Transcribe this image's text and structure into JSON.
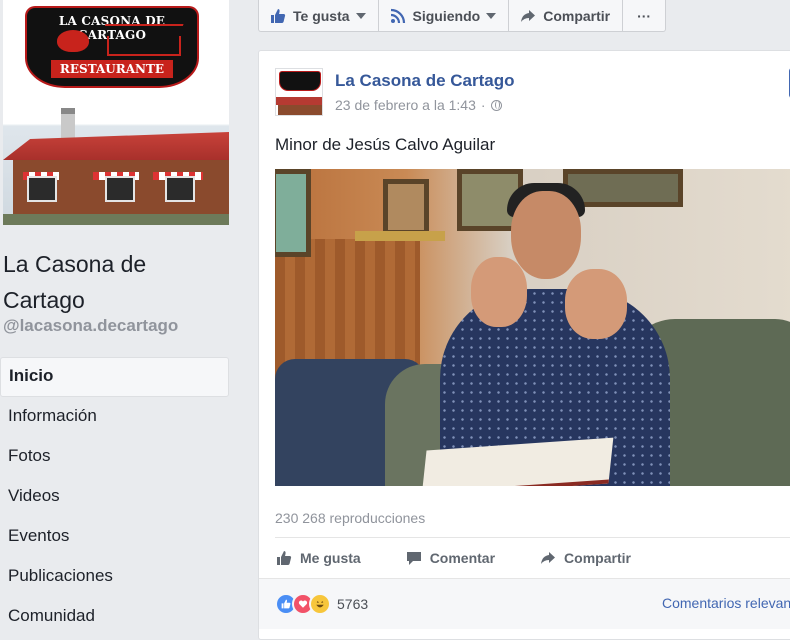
{
  "page": {
    "cover_sign_top": "LA CASONA DE CARTAGO",
    "cover_sign_bottom": "RESTAURANTE",
    "name": "La Casona de Cartago",
    "handle": "@lacasona.decartago"
  },
  "nav": {
    "items": [
      {
        "label": "Inicio",
        "active": true
      },
      {
        "label": "Información"
      },
      {
        "label": "Fotos"
      },
      {
        "label": "Videos"
      },
      {
        "label": "Eventos"
      },
      {
        "label": "Publicaciones"
      },
      {
        "label": "Comunidad"
      }
    ]
  },
  "actionbar": {
    "like_label": "Te gusta",
    "follow_label": "Siguiendo",
    "share_label": "Compartir",
    "more_label": "···"
  },
  "post": {
    "author": "La Casona de Cartago",
    "date": "23 de febrero a la 1:43",
    "separator": "·",
    "text": "Minor de Jesús Calvo Aguilar",
    "views": "230 268 reproducciones",
    "actions": {
      "like": "Me gusta",
      "comment": "Comentar",
      "share": "Compartir"
    },
    "reactions_count": "5763",
    "comments_sort": "Comentarios relevantes"
  },
  "icons": {
    "like": "thumbs-up-icon",
    "follow": "rss-icon",
    "share": "share-arrow-icon",
    "comment": "comment-bubble-icon",
    "privacy": "globe-icon"
  },
  "colors": {
    "brand_blue": "#4267b2",
    "link_blue": "#365899",
    "like_reaction": "#4a8ef5",
    "love_reaction": "#f25268",
    "haha_reaction": "#f7c63b"
  }
}
